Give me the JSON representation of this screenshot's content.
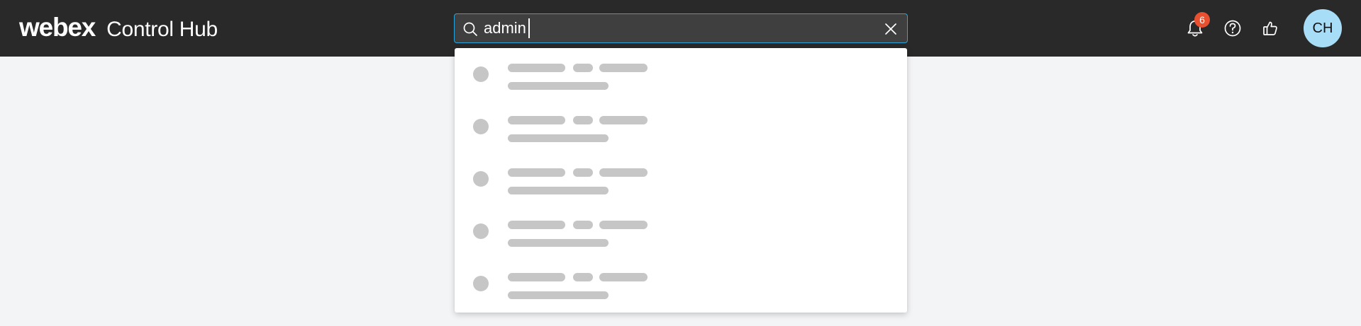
{
  "header": {
    "logo_text": "webex",
    "product_name": "Control Hub",
    "background_color": "#292929"
  },
  "search": {
    "value": "admin",
    "icon": "search-icon",
    "clear_icon": "close-icon",
    "border_color": "#2aa3d8"
  },
  "actions": {
    "notifications": {
      "icon": "bell-icon",
      "badge_count": "6",
      "badge_color": "#e8502f"
    },
    "help": {
      "icon": "help-circle-icon"
    },
    "feedback": {
      "icon": "thumbs-up-icon"
    },
    "avatar": {
      "initials": "CH",
      "color": "#a8ddf7"
    }
  },
  "search_results": {
    "state": "loading",
    "placeholder_rows": 5,
    "skeleton_color": "#c6c6c6"
  },
  "page": {
    "background_color": "#f3f4f6"
  }
}
